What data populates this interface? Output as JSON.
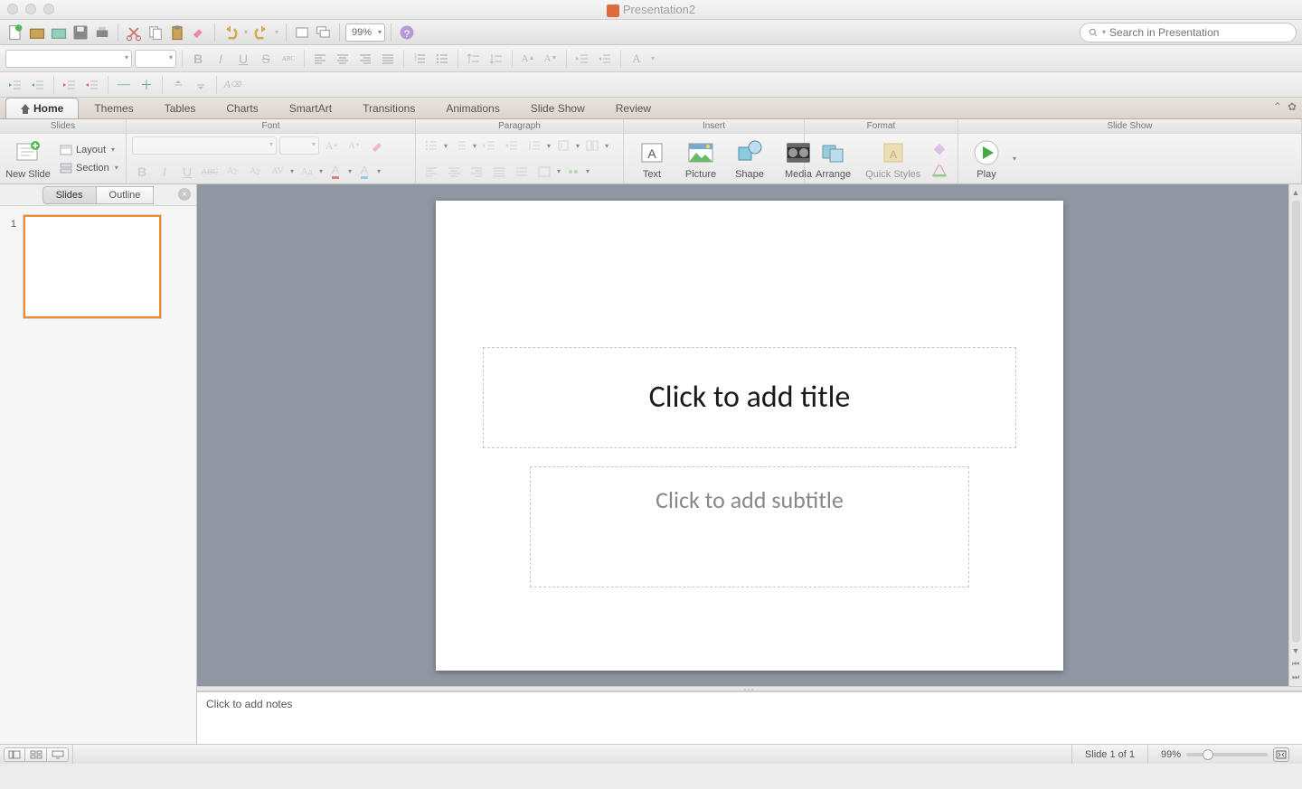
{
  "window": {
    "title": "Presentation2"
  },
  "toolbar": {
    "zoom": "99%",
    "search_placeholder": "Search in Presentation"
  },
  "tabs": [
    "Home",
    "Themes",
    "Tables",
    "Charts",
    "SmartArt",
    "Transitions",
    "Animations",
    "Slide Show",
    "Review"
  ],
  "ribbon": {
    "groups": {
      "slides": {
        "title": "Slides",
        "new_slide": "New Slide",
        "layout": "Layout",
        "section": "Section"
      },
      "font": {
        "title": "Font"
      },
      "paragraph": {
        "title": "Paragraph"
      },
      "insert": {
        "title": "Insert",
        "text": "Text",
        "picture": "Picture",
        "shape": "Shape",
        "media": "Media"
      },
      "format": {
        "title": "Format",
        "arrange": "Arrange",
        "quick_styles": "Quick Styles"
      },
      "slideshow": {
        "title": "Slide Show",
        "play": "Play"
      }
    }
  },
  "sidebar": {
    "tabs": [
      "Slides",
      "Outline"
    ],
    "slides": [
      {
        "num": "1"
      }
    ]
  },
  "canvas": {
    "title_placeholder": "Click to add title",
    "subtitle_placeholder": "Click to add subtitle"
  },
  "notes": {
    "placeholder": "Click to add notes"
  },
  "status": {
    "slide": "Slide 1 of 1",
    "zoom": "99%"
  }
}
